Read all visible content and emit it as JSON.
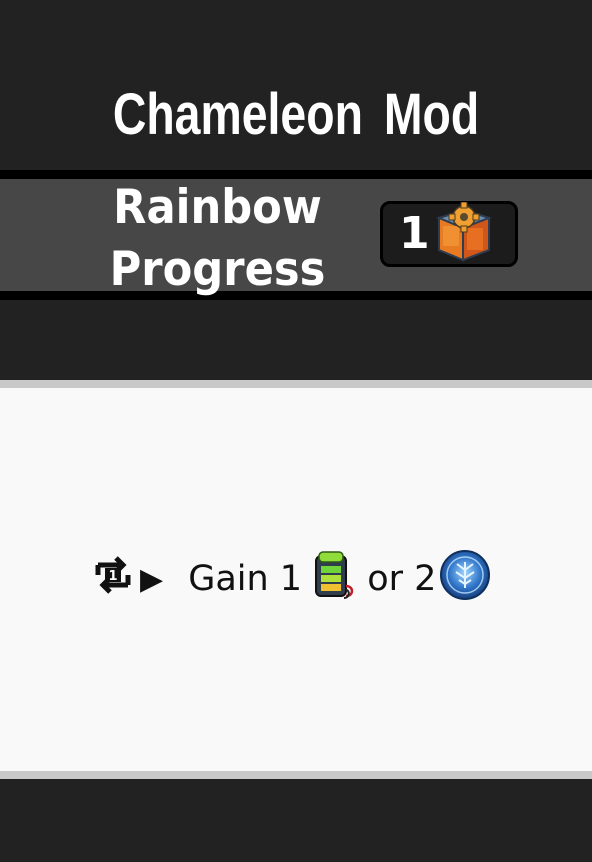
{
  "card": {
    "title": "Chameleon Mod",
    "name_line1": "Rainbow",
    "name_line2": "Progress",
    "cost": {
      "value": "1",
      "icon": "mech-part-crate-icon"
    },
    "effect": {
      "trigger_icon": "action-repeat-icon",
      "arrow": "▶",
      "gain_text": " Gain 1",
      "or_text": " or 2",
      "resource_1_icon": "battery-icon",
      "resource_2_icon": "blue-token-icon"
    }
  },
  "colors": {
    "background": "#222222",
    "band": "#474747",
    "card": "#f9f9f9",
    "separator": "#c9c9c9"
  }
}
